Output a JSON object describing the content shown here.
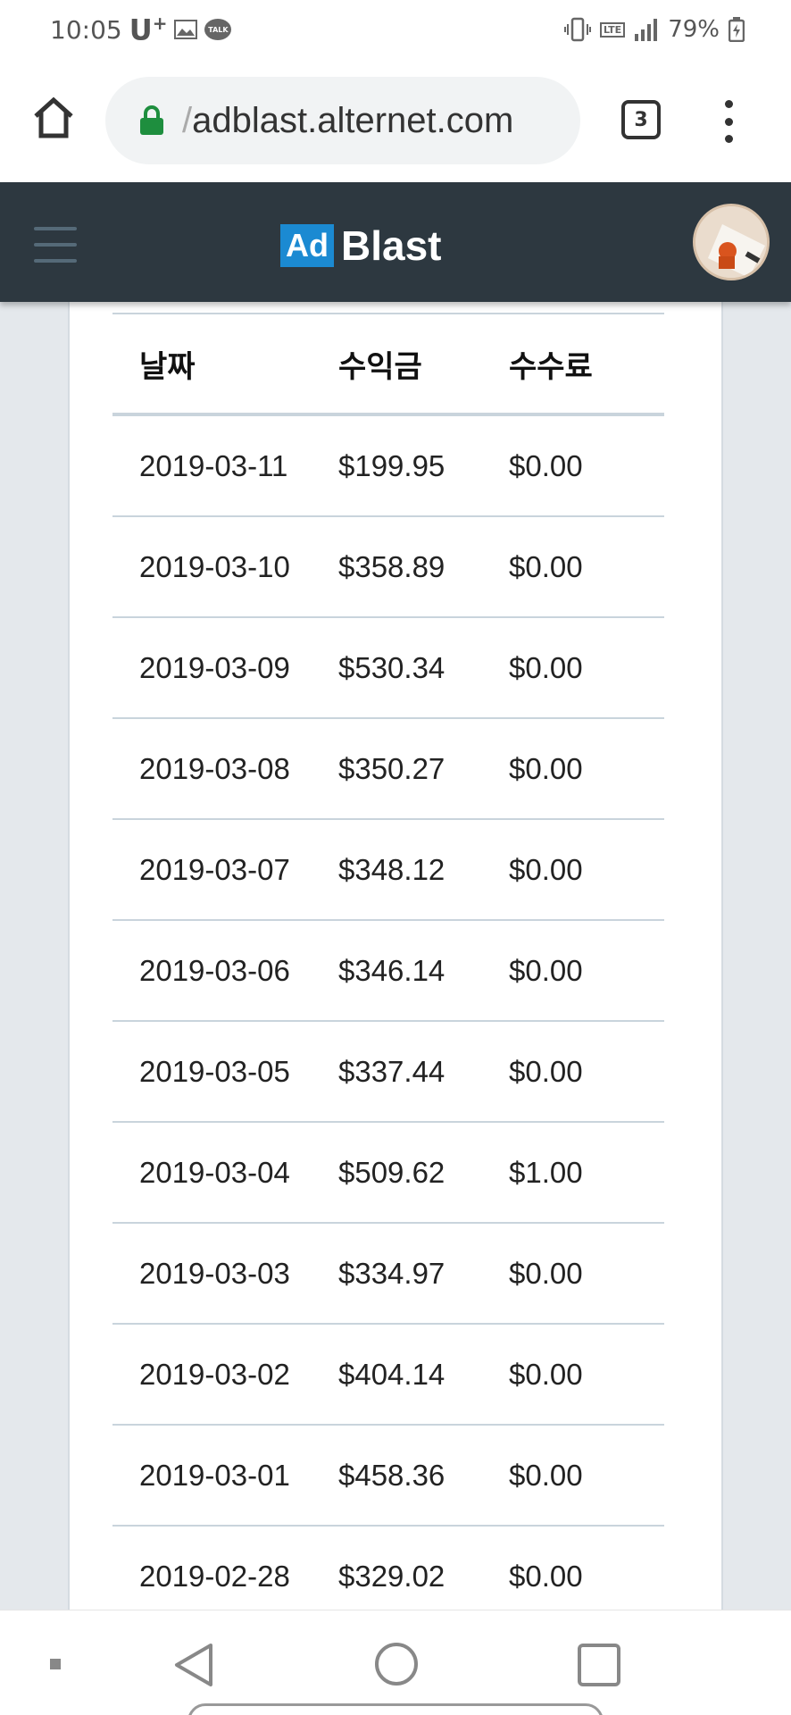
{
  "status_bar": {
    "time": "10:05",
    "carrier": "U",
    "carrier_sup": "+",
    "talk_label": "TALK",
    "battery": "79%",
    "network": "LTE"
  },
  "browser": {
    "url_prefix": "/",
    "url": "adblast.alternet.com",
    "tab_count": "3"
  },
  "app_header": {
    "logo_ad": "Ad",
    "logo_blast": "Blast"
  },
  "table": {
    "headers": [
      "날짜",
      "수익금",
      "수수료"
    ],
    "rows": [
      [
        "2019-03-11",
        "$199.95",
        "$0.00"
      ],
      [
        "2019-03-10",
        "$358.89",
        "$0.00"
      ],
      [
        "2019-03-09",
        "$530.34",
        "$0.00"
      ],
      [
        "2019-03-08",
        "$350.27",
        "$0.00"
      ],
      [
        "2019-03-07",
        "$348.12",
        "$0.00"
      ],
      [
        "2019-03-06",
        "$346.14",
        "$0.00"
      ],
      [
        "2019-03-05",
        "$337.44",
        "$0.00"
      ],
      [
        "2019-03-04",
        "$509.62",
        "$1.00"
      ],
      [
        "2019-03-03",
        "$334.97",
        "$0.00"
      ],
      [
        "2019-03-02",
        "$404.14",
        "$0.00"
      ],
      [
        "2019-03-01",
        "$458.36",
        "$0.00"
      ],
      [
        "2019-02-28",
        "$329.02",
        "$0.00"
      ]
    ]
  },
  "colors": {
    "header_bg": "#2d3840",
    "logo_accent": "#1b8ad2",
    "lock_green": "#1e8e3e"
  }
}
